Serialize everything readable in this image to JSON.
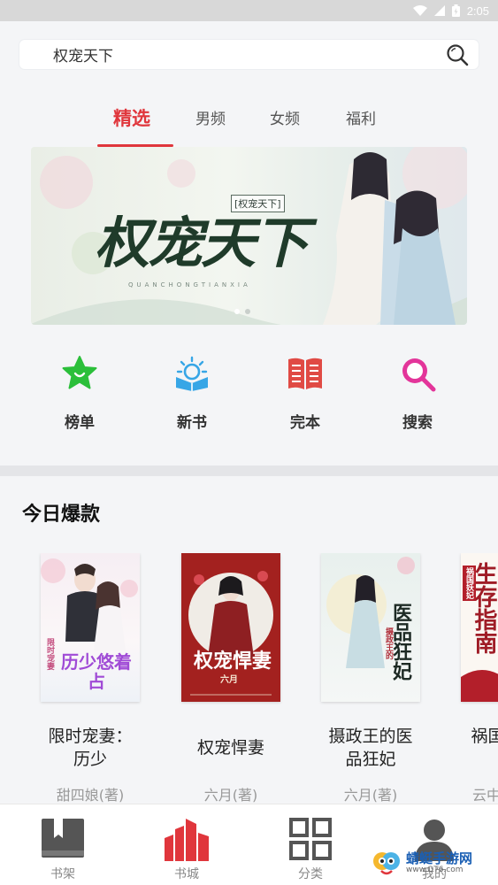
{
  "status_bar": {
    "time": "2:05",
    "icons": [
      "wifi-icon",
      "signal-icon",
      "battery-icon"
    ]
  },
  "search": {
    "value": "权宠天下"
  },
  "tabs": [
    {
      "label": "精选",
      "active": true
    },
    {
      "label": "男频",
      "active": false
    },
    {
      "label": "女频",
      "active": false
    },
    {
      "label": "福利",
      "active": false
    }
  ],
  "banner": {
    "title": "权宠天下",
    "badge": "[权宠天下]",
    "subtitle": "QUANCHONGTIANXIA",
    "page_count": 2,
    "current_page": 1
  },
  "quick_links": [
    {
      "label": "榜单",
      "icon": "star-icon",
      "color": "#2bbf3a"
    },
    {
      "label": "新书",
      "icon": "book-light-icon",
      "color": "#37a6e6"
    },
    {
      "label": "完本",
      "icon": "open-book-icon",
      "color": "#e04a44"
    },
    {
      "label": "搜索",
      "icon": "search-icon",
      "color": "#e3359a"
    }
  ],
  "section": {
    "title": "今日爆款"
  },
  "books": [
    {
      "title": "限时宠妻：历少",
      "author": "甜四娘(著)",
      "cover_title": "历少悠着占",
      "cover_sub": "限时宠妻"
    },
    {
      "title": "权宠悍妻",
      "author": "六月(著)",
      "cover_title": "权宠悍妻",
      "cover_sub": "六月"
    },
    {
      "title": "摄政王的医品狂妃",
      "author": "六月(著)",
      "cover_title": "医品狂妃",
      "cover_sub": "摄政王的"
    },
    {
      "title": "祸国生存指南",
      "author": "云中",
      "cover_title": "生存指南",
      "cover_sub": "祸国妖妃"
    }
  ],
  "bottom_nav": [
    {
      "label": "书架",
      "icon": "bookshelf-icon",
      "active": false
    },
    {
      "label": "书城",
      "icon": "bookstore-icon",
      "active": true
    },
    {
      "label": "分类",
      "icon": "category-grid-icon",
      "active": false
    },
    {
      "label": "我的",
      "icon": "profile-icon",
      "active": false
    }
  ],
  "watermark": {
    "text": "蜻蜓手游网",
    "url": "www.QT6.com"
  },
  "colors": {
    "accent": "#e0363c",
    "background": "#f4f5f7"
  }
}
